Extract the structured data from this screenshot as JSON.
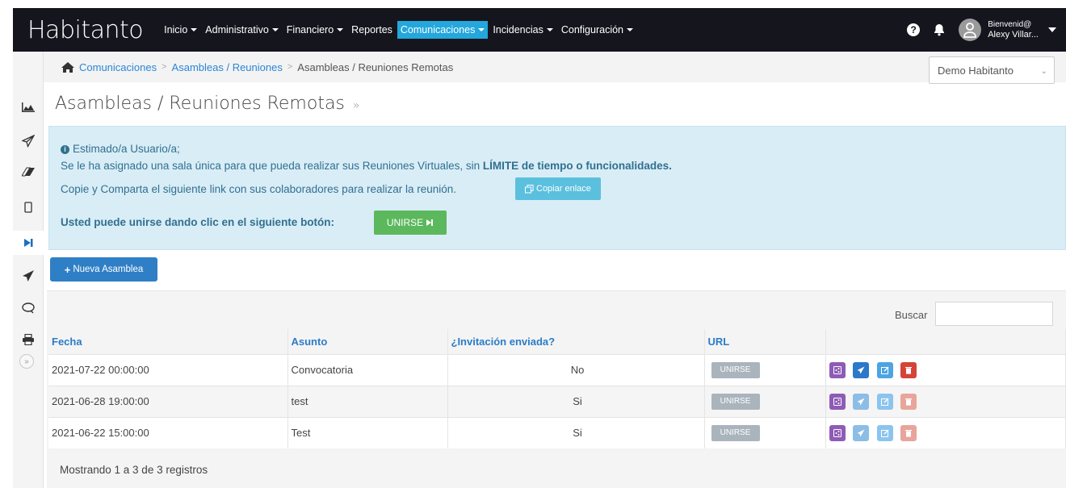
{
  "app": {
    "brand": "Habitanto"
  },
  "nav": {
    "items": [
      {
        "label": "Inicio",
        "active": false
      },
      {
        "label": "Administrativo",
        "active": false
      },
      {
        "label": "Financiero",
        "active": false
      },
      {
        "label": "Reportes",
        "active": false
      },
      {
        "label": "Comunicaciones",
        "active": true
      },
      {
        "label": "Incidencias",
        "active": false
      },
      {
        "label": "Configuración",
        "active": false
      }
    ],
    "user_greeting": "Bienvenid@",
    "user_name": "Alexy Villar..."
  },
  "breadcrumb": {
    "items": [
      "Comunicaciones",
      "Asambleas / Reuniones",
      "Asambleas / Reuniones Remotas"
    ]
  },
  "community_select": {
    "value": "Demo Habitanto"
  },
  "page": {
    "title": "Asambleas / Reuniones Remotas"
  },
  "alert": {
    "greeting": "Estimado/a Usuario/a;",
    "line1_prefix": "Se le ha asignado una sala única para que pueda realizar sus Reuniones Virtuales, sin ",
    "line1_bold": "LÍMITE de tiempo o funcionalidades.",
    "line2": "Copie y Comparta el siguiente link con sus colaboradores para realizar la reunión.",
    "copy_label": "Copiar enlace",
    "line3": "Usted puede unirse dando clic en el siguiente botón:",
    "join_label": "UNIRSE"
  },
  "new_button": {
    "label": "Nueva Asamblea"
  },
  "table": {
    "search_label": "Buscar",
    "columns": [
      "Fecha",
      "Asunto",
      "¿Invitación enviada?",
      "URL",
      ""
    ],
    "rows": [
      {
        "fecha": "2021-07-22 00:00:00",
        "asunto": "Convocatoria",
        "invitacion": "No",
        "url": "UNIRSE"
      },
      {
        "fecha": "2021-06-28 19:00:00",
        "asunto": "test",
        "invitacion": "Si",
        "url": "UNIRSE"
      },
      {
        "fecha": "2021-06-22 15:00:00",
        "asunto": "Test",
        "invitacion": "Si",
        "url": "UNIRSE"
      }
    ],
    "footer": "Mostrando 1 a 3 de 3 registros"
  },
  "colors": {
    "navbar": "#14151d",
    "nav_active": "#23a7dc",
    "alert_bg": "#d9edf7",
    "primary": "#2f7fc6",
    "success": "#5cb85c",
    "info": "#5bc0de"
  }
}
